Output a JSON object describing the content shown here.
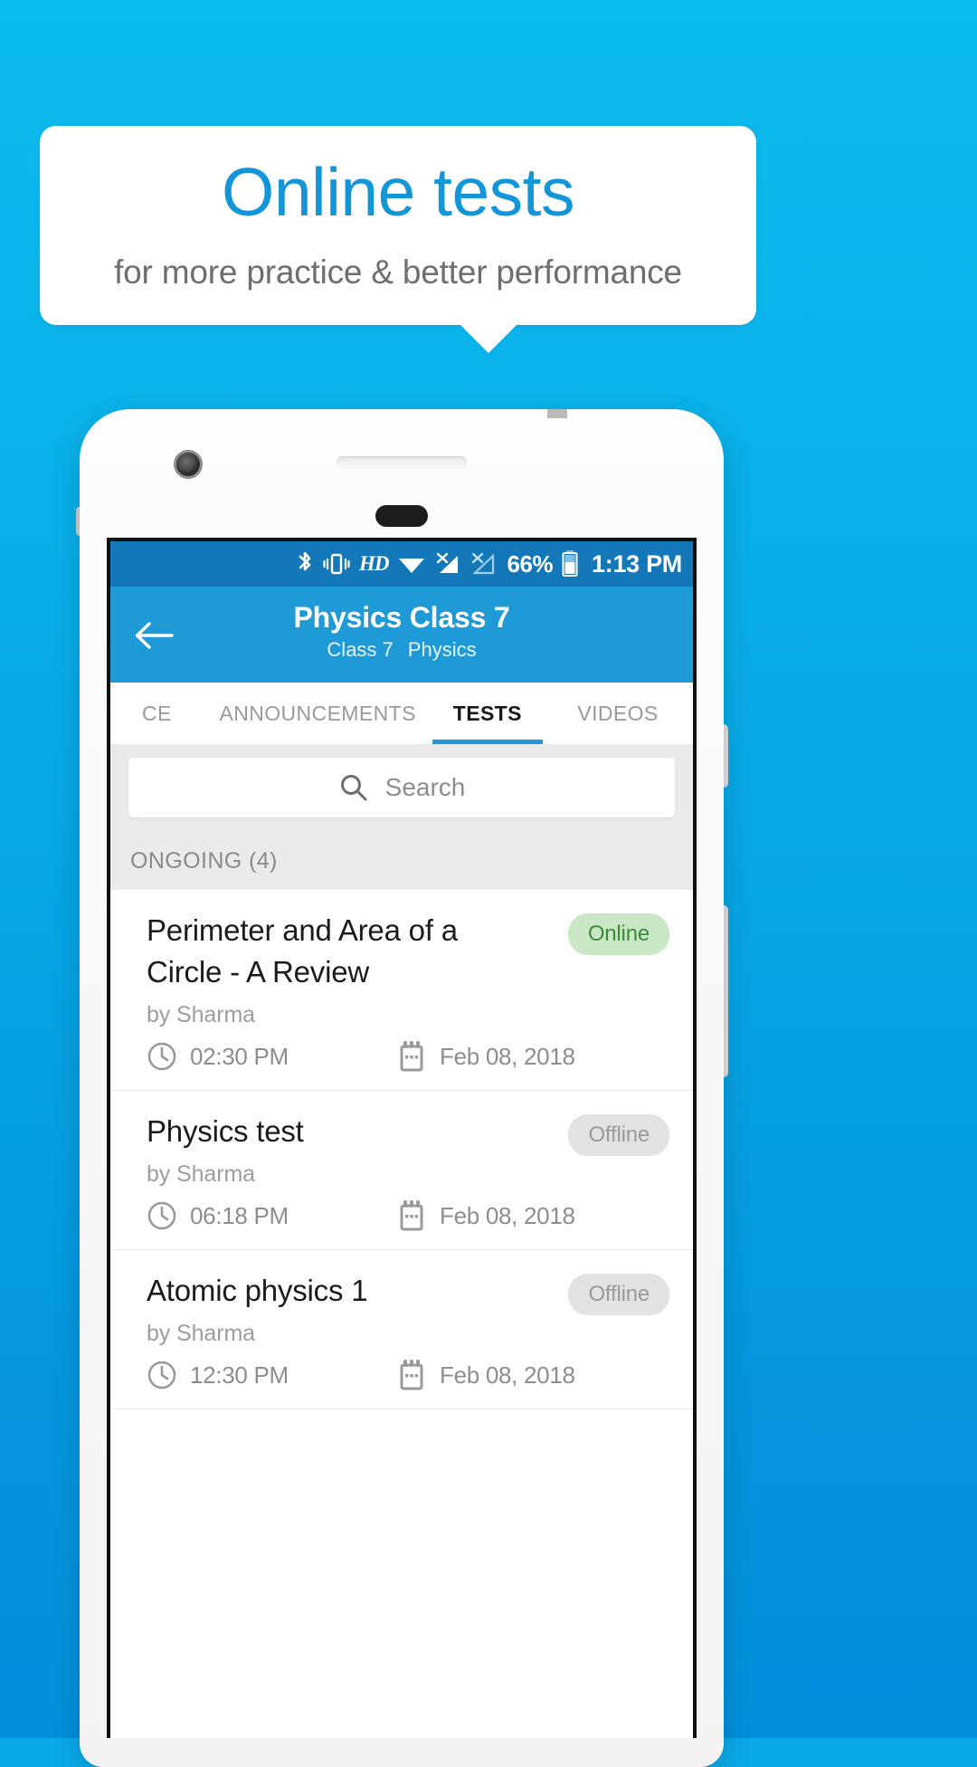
{
  "promo": {
    "headline": "Online tests",
    "subheadline": "for more practice & better performance",
    "headline_color": "#1296d8",
    "background_color": "#0aa9e8"
  },
  "status_bar": {
    "icons": [
      "bluetooth-icon",
      "vibrate-icon",
      "hd-icon",
      "wifi-icon",
      "signal-1-no-service-icon",
      "signal-2-no-service-icon",
      "battery-icon"
    ],
    "hd_label": "HD",
    "battery_percent": "66%",
    "time": "1:13 PM",
    "background_color": "#1478b8"
  },
  "app_bar": {
    "back_icon": "arrow-left-icon",
    "title": "Physics Class 7",
    "subtitle_class": "Class 7",
    "subtitle_subject": "Physics",
    "background_color": "#1e9bd7"
  },
  "tabs": {
    "items": [
      {
        "label": "CE",
        "active": false
      },
      {
        "label": "ANNOUNCEMENTS",
        "active": false
      },
      {
        "label": "TESTS",
        "active": true
      },
      {
        "label": "VIDEOS",
        "active": false
      }
    ],
    "indicator_color": "#1e9bd7"
  },
  "search": {
    "icon": "search-icon",
    "placeholder": "Search",
    "value": ""
  },
  "section": {
    "label": "ONGOING (4)"
  },
  "tests": [
    {
      "title": "Perimeter and Area of a Circle - A Review",
      "author": "by Sharma",
      "status": "Online",
      "status_kind": "online",
      "time_icon": "clock-icon",
      "time": "02:30 PM",
      "date_icon": "calendar-icon",
      "date": "Feb 08, 2018"
    },
    {
      "title": "Physics test",
      "author": "by Sharma",
      "status": "Offline",
      "status_kind": "offline",
      "time_icon": "clock-icon",
      "time": "06:18 PM",
      "date_icon": "calendar-icon",
      "date": "Feb 08, 2018"
    },
    {
      "title": "Atomic physics 1",
      "author": "by Sharma",
      "status": "Offline",
      "status_kind": "offline",
      "time_icon": "clock-icon",
      "time": "12:30 PM",
      "date_icon": "calendar-icon",
      "date": "Feb 08, 2018"
    }
  ]
}
